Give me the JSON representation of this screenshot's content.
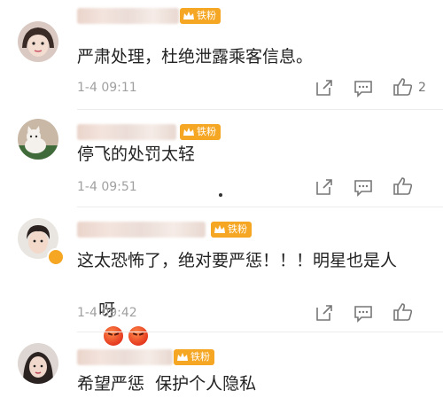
{
  "badge_label": "铁粉",
  "comments": [
    {
      "username": "",
      "text": "严肃处理，杜绝泄露乘客信息。",
      "time": "1-4 09:11",
      "likes": "2",
      "avatar": "avatar-girl-icon"
    },
    {
      "username": "",
      "text": "停飞的处罚太轻",
      "time": "1-4 09:51",
      "likes": "",
      "avatar": "avatar-cat-icon"
    },
    {
      "username": "",
      "text_line1": "这太恐怖了，绝对要严惩！！！明星也是人",
      "text_line2": "呀",
      "time": "1-4 09:42",
      "likes": "",
      "avatar": "avatar-boy-verified-icon",
      "emojis": [
        "angry-emoji-icon",
        "angry-emoji-icon"
      ]
    },
    {
      "username": "",
      "text": "希望严惩  保护个人隐私",
      "avatar": "avatar-woman-icon"
    }
  ],
  "colors": {
    "badge": "#f5a623",
    "timestamp": "#a0a0a0",
    "text": "#222222"
  }
}
